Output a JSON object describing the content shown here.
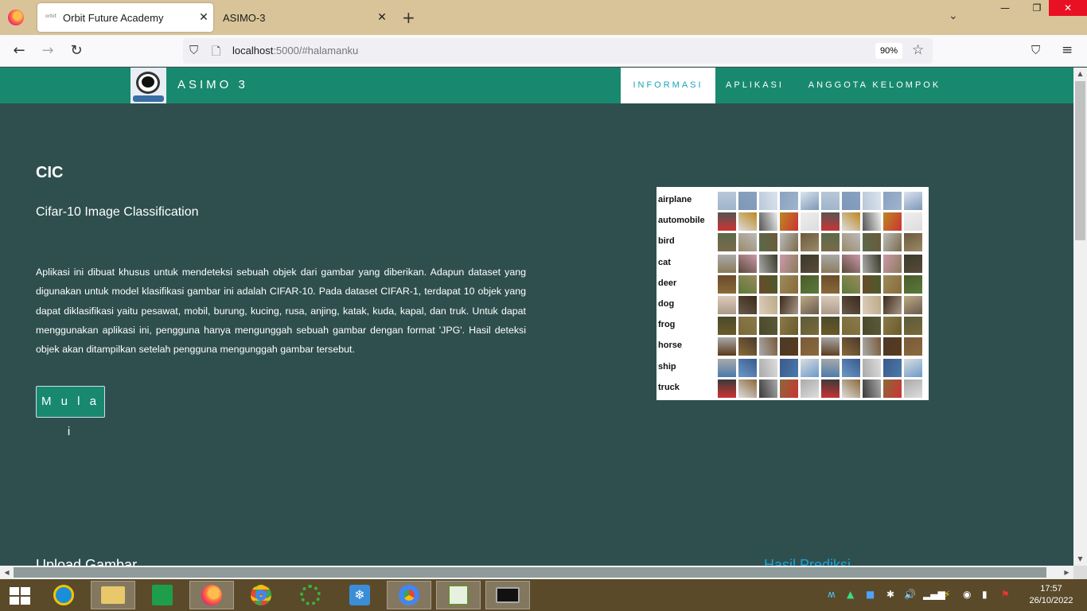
{
  "browser": {
    "tabs": [
      {
        "title": "Orbit Future Academy",
        "favicon_text": "orbit"
      },
      {
        "title": "ASIMO-3"
      }
    ],
    "url_host": "localhost",
    "url_rest": ":5000/#halamanku",
    "zoom": "90%"
  },
  "site": {
    "brand": "ASIMO 3",
    "nav": [
      {
        "label": "INFORMASI",
        "active": true
      },
      {
        "label": "APLIKASI",
        "active": false
      },
      {
        "label": "ANGGOTA KELOMPOK",
        "active": false
      }
    ]
  },
  "hero": {
    "heading": "CIC",
    "subtitle": "Cifar-10 Image Classification",
    "description": "Aplikasi ini dibuat khusus untuk mendeteksi sebuah objek dari gambar yang diberikan. Adapun dataset yang digunakan untuk model klasifikasi gambar ini adalah CIFAR-10. Pada dataset CIFAR-1, terdapat 10 objek yang dapat diklasifikasi yaitu pesawat, mobil, burung, kucing, rusa, anjing, katak, kuda, kapal, dan truk. Untuk dapat menggunakan aplikasi ini, pengguna hanya mengunggah sebuah gambar dengan format 'JPG'. Hasil deteksi objek akan ditampilkan setelah pengguna mengunggah gambar tersebut.",
    "button": "M u l a i"
  },
  "cifar_classes": [
    "airplane",
    "automobile",
    "bird",
    "cat",
    "deer",
    "dog",
    "frog",
    "horse",
    "ship",
    "truck"
  ],
  "sections": {
    "upload": "Upload Gambar",
    "result": "Hasil Prediksi"
  },
  "taskbar": {
    "time": "17:57",
    "date": "26/10/2022"
  },
  "colors": {
    "page_bg": "#2f4f4f",
    "nav_bg": "#18896f",
    "accent": "#18a3b8",
    "result_heading": "#19a4d8"
  }
}
